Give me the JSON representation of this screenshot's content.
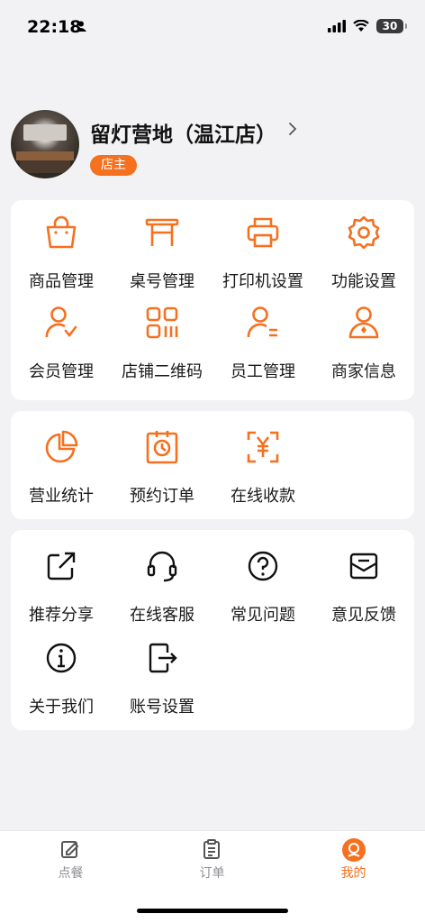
{
  "status": {
    "time": "22:18",
    "battery": "30"
  },
  "profile": {
    "shop_name": "留灯营地（温江店）",
    "role": "店主"
  },
  "management": [
    {
      "label": "商品管理",
      "icon": "shopping-bag-icon"
    },
    {
      "label": "桌号管理",
      "icon": "table-icon"
    },
    {
      "label": "打印机设置",
      "icon": "printer-icon"
    },
    {
      "label": "功能设置",
      "icon": "gear-icon"
    },
    {
      "label": "会员管理",
      "icon": "member-check-icon"
    },
    {
      "label": "店铺二维码",
      "icon": "qr-code-icon"
    },
    {
      "label": "员工管理",
      "icon": "staff-icon"
    },
    {
      "label": "商家信息",
      "icon": "merchant-icon"
    }
  ],
  "business": [
    {
      "label": "营业统计",
      "icon": "pie-chart-icon"
    },
    {
      "label": "预约订单",
      "icon": "clock-calendar-icon"
    },
    {
      "label": "在线收款",
      "icon": "yuan-scan-icon"
    }
  ],
  "services": [
    {
      "label": "推荐分享",
      "icon": "share-icon"
    },
    {
      "label": "在线客服",
      "icon": "headset-icon"
    },
    {
      "label": "常见问题",
      "icon": "question-icon"
    },
    {
      "label": "意见反馈",
      "icon": "feedback-icon"
    },
    {
      "label": "关于我们",
      "icon": "info-icon"
    },
    {
      "label": "账号设置",
      "icon": "logout-icon"
    }
  ],
  "tabs": [
    {
      "label": "点餐",
      "icon": "edit-icon",
      "active": false
    },
    {
      "label": "订单",
      "icon": "clipboard-icon",
      "active": false
    },
    {
      "label": "我的",
      "icon": "user-circle-icon",
      "active": true
    }
  ],
  "colors": {
    "accent": "#f5701f",
    "background": "#f2f2f4",
    "card": "#ffffff"
  }
}
